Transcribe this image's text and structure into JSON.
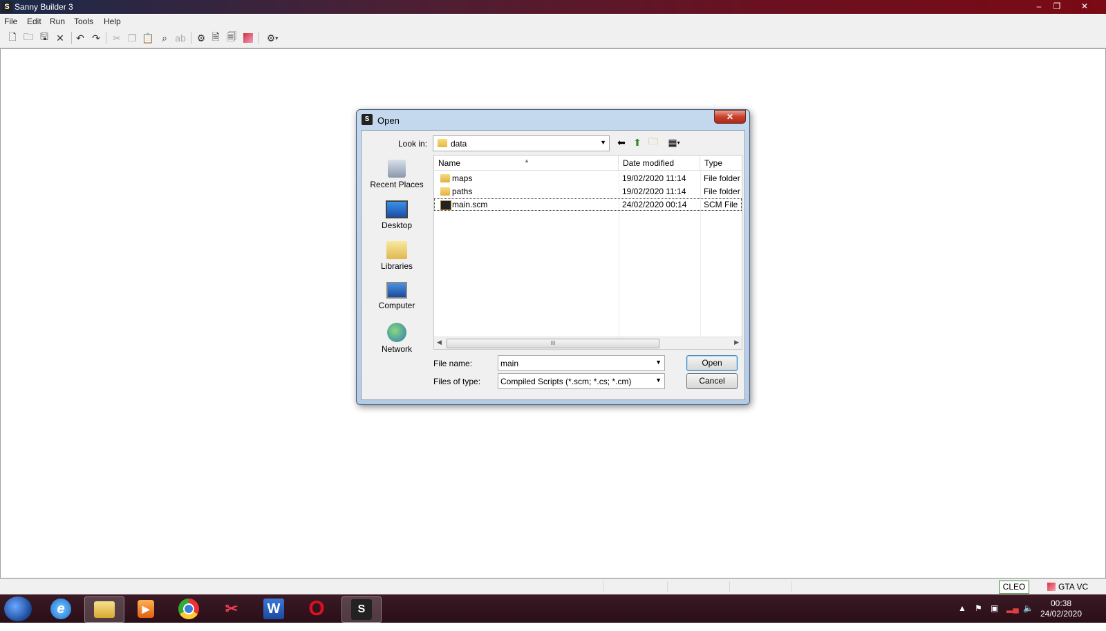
{
  "app": {
    "title": "Sanny Builder 3",
    "window_buttons": [
      "–",
      "❐",
      "✕"
    ]
  },
  "menu": [
    "File",
    "Edit",
    "Run",
    "Tools",
    "Help"
  ],
  "toolbar": {
    "icons": [
      "new-file-icon",
      "open-folder-icon",
      "save-icon",
      "close-icon",
      "undo-icon",
      "redo-icon",
      "cut-icon",
      "copy-icon",
      "paste-icon",
      "find-icon",
      "replace-icon",
      "compile-icon",
      "decompile-icon",
      "compile-decompile-icon",
      "ide-icon",
      "options-gear-icon"
    ]
  },
  "dialog": {
    "title": "Open",
    "close": "✕",
    "look_in_label": "Look in:",
    "look_in_value": "data",
    "places": [
      "Recent Places",
      "Desktop",
      "Libraries",
      "Computer",
      "Network"
    ],
    "columns": {
      "name": "Name",
      "date": "Date modified",
      "type": "Type"
    },
    "files": [
      {
        "name": "maps",
        "date": "19/02/2020 11:14",
        "type": "File folder",
        "icon": "folder-icon"
      },
      {
        "name": "paths",
        "date": "19/02/2020 11:14",
        "type": "File folder",
        "icon": "folder-icon"
      },
      {
        "name": "main.scm",
        "date": "24/02/2020 00:14",
        "type": "SCM File",
        "icon": "scm-file-icon",
        "selected": true
      }
    ],
    "file_name_label": "File name:",
    "file_name_value": "main",
    "file_type_label": "Files of type:",
    "file_type_value": "Compiled Scripts (*.scm; *.cs; *.cm)",
    "open_button": "Open",
    "cancel_button": "Cancel",
    "scroll_thumb": "III"
  },
  "statusbar": {
    "cleo": "CLEO",
    "game": "GTA VC"
  },
  "taskbar": {
    "apps": [
      "internet-explorer-icon",
      "file-explorer-icon",
      "media-player-icon",
      "chrome-icon",
      "snipping-tool-icon",
      "word-icon",
      "opera-icon",
      "sanny-builder-icon"
    ],
    "word_letter": "W",
    "opera_letter": "O",
    "time": "00:38",
    "date": "24/02/2020"
  }
}
